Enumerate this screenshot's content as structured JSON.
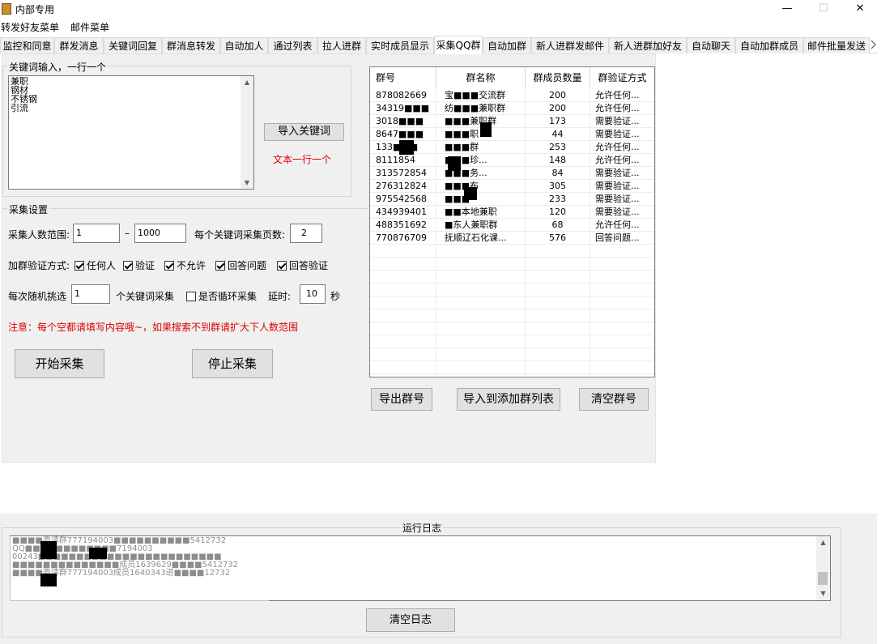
{
  "window": {
    "title": "内部专用",
    "minimize": "—",
    "maximize": "☐",
    "close": "✕"
  },
  "menu": [
    "转发好友菜单",
    "邮件菜单"
  ],
  "tabs": [
    "监控和同意",
    "群发消息",
    "关键词回复",
    "群消息转发",
    "自动加人",
    "通过列表",
    "拉人进群",
    "实时成员显示",
    "采集QQ群",
    "自动加群",
    "新人进群发邮件",
    "新人进群加好友",
    "自动聊天",
    "自动加群成员",
    "邮件批量发送"
  ],
  "active_tab": "采集QQ群",
  "keywords": {
    "group_title": "关键词输入，一行一个",
    "lines": [
      "兼职",
      "钢材",
      "不锈钢",
      "引流"
    ],
    "import_button": "导入关键词",
    "hint": "文本一行一个"
  },
  "settings": {
    "group_title": "采集设置",
    "range_label": "采集人数范围:",
    "range_min": "1",
    "range_sep": "–",
    "range_max": "1000",
    "pages_label": "每个关键词采集页数:",
    "pages_value": "2",
    "verify_label": "加群验证方式:",
    "verify_options": [
      {
        "label": "任何人",
        "checked": true
      },
      {
        "label": "验证",
        "checked": true
      },
      {
        "label": "不允许",
        "checked": true
      },
      {
        "label": "回答问题",
        "checked": true
      },
      {
        "label": "回答验证",
        "checked": true
      }
    ],
    "random_label": "每次随机挑选",
    "random_value": "1",
    "random_suffix": "个关键词采集",
    "loop_label": "是否循环采集",
    "loop_checked": false,
    "delay_label": "延时:",
    "delay_value": "10",
    "delay_unit": "秒",
    "warning": "注意：每个空都请填写内容哦~，如果搜索不到群请扩大下人数范围",
    "start_button": "开始采集",
    "stop_button": "停止采集"
  },
  "grid": {
    "columns": [
      "群号",
      "群名称",
      "群成员数量",
      "群验证方式"
    ],
    "rows": [
      [
        "878082669",
        "宝■■■交流群",
        "200",
        "允许任何..."
      ],
      [
        "34319■■■",
        "纺■■■兼职群",
        "200",
        "允许任何..."
      ],
      [
        "3018■■■",
        "■■■兼职群",
        "173",
        "需要验证..."
      ],
      [
        "8647■■■",
        "■■■职",
        "44",
        "需要验证..."
      ],
      [
        "133■■■",
        "■■■群",
        "253",
        "允许任何..."
      ],
      [
        "8111854",
        "■■■珍...",
        "148",
        "允许任何..."
      ],
      [
        "313572854",
        "■■■务...",
        "84",
        "需要验证..."
      ],
      [
        "276312824",
        "■■■布",
        "305",
        "需要验证..."
      ],
      [
        "975542568",
        "■■■",
        "233",
        "需要验证..."
      ],
      [
        "434939401",
        "■■本地兼职",
        "120",
        "需要验证..."
      ],
      [
        "488351692",
        "■东人兼职群",
        "68",
        "允许任何..."
      ],
      [
        "770876709",
        "抚顺辽石化课...",
        "576",
        "回答问题..."
      ]
    ],
    "empty_rows": 10
  },
  "grid_buttons": {
    "export": "导出群号",
    "import_to_list": "导入到添加群列表",
    "clear": "清空群号"
  },
  "log": {
    "title": "运行日志",
    "lines": [
      "■■■■邀请群777194003■■■■■■■■■■5412732",
      "QQ■■■■■■■■■■■■7194003",
      "00243■■■■■■■■■■■■■■■■■■■■■■■■",
      "■■■■■■■■■■■■■■成员1639629■■■■5412732",
      "■■■■邀请群777194003成员1640343进■■■■12732"
    ],
    "clear_button": "清空日志"
  }
}
